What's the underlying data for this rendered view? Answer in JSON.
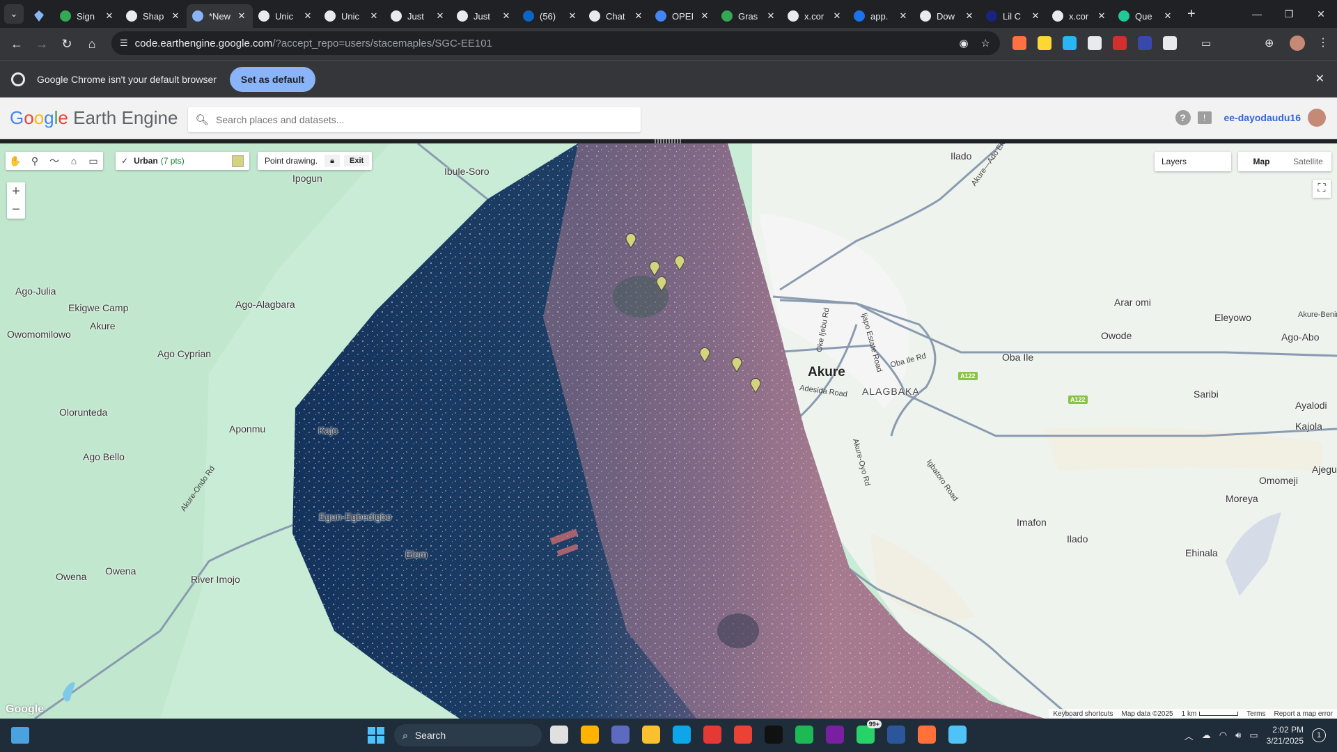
{
  "browser": {
    "tabs": [
      {
        "label": "Sign",
        "color": "#34a853",
        "active": false
      },
      {
        "label": "Shap",
        "color": "#e8eaed",
        "active": false
      },
      {
        "label": "*New",
        "color": "#8ab4f8",
        "active": true
      },
      {
        "label": "Unic",
        "color": "#e8eaed",
        "active": false
      },
      {
        "label": "Unic",
        "color": "#e8eaed",
        "active": false
      },
      {
        "label": "Just",
        "color": "#e8eaed",
        "active": false
      },
      {
        "label": "Just",
        "color": "#e8eaed",
        "active": false
      },
      {
        "label": "(56)",
        "color": "#0a66c2",
        "active": false
      },
      {
        "label": "Chat",
        "color": "#e8eaed",
        "active": false
      },
      {
        "label": "OPEI",
        "color": "#4285f4",
        "active": false
      },
      {
        "label": "Gras",
        "color": "#34a853",
        "active": false
      },
      {
        "label": "x.cor",
        "color": "#e8eaed",
        "active": false
      },
      {
        "label": "app.",
        "color": "#1a73e8",
        "active": false
      },
      {
        "label": "Dow",
        "color": "#e8eaed",
        "active": false
      },
      {
        "label": "Lil C",
        "color": "#1a237e",
        "active": false
      },
      {
        "label": "x.cor",
        "color": "#e8eaed",
        "active": false
      },
      {
        "label": "Que",
        "color": "#20c997",
        "active": false
      }
    ],
    "url_main": "code.earthengine.google.com",
    "url_rest": "/?accept_repo=users/stacemaples/SGC-EE101",
    "extension_colors": [
      "#ff7043",
      "#fdd835",
      "#29b6f6",
      "#e8eaed",
      "#d32f2f",
      "#3949ab",
      "#e8eaed"
    ]
  },
  "infobar": {
    "message": "Google Chrome isn't your default browser",
    "button": "Set as default"
  },
  "gee": {
    "logo_rest": "Earth Engine",
    "search_placeholder": "Search places and datasets...",
    "user": "ee-dayodaudu16"
  },
  "map": {
    "drawing": {
      "layer_name": "Urban",
      "layer_count": "(7 pts)",
      "layer_color": "#d4d47c",
      "mode_label": "Point drawing.",
      "exit_label": "Exit"
    },
    "layers_label": "Layers",
    "map_type": [
      "Map",
      "Satellite"
    ],
    "labels": [
      "Ipogun",
      "Ibule-Soro",
      "Ilado",
      "Ago-Julia",
      "Ekigwe Camp",
      "Akure",
      "Owomomilowo",
      "Ago-Alagbara",
      "Ago Cyprian",
      "Arar omi",
      "Eleyowo",
      "Owode",
      "Ago-Abo",
      "Oba Ile",
      "Saribi",
      "Ayalodi",
      "Kajola",
      "Olorunteda",
      "Aponmu",
      "Kajo",
      "Ago Bello",
      "Ajegu",
      "Omomeji",
      "Moreya",
      "Egun-Egbedigbo",
      "Imafon",
      "Ilado",
      "Ehinala",
      "Elem",
      "Owena",
      "Owena",
      "River Imojo"
    ],
    "town": "Akure",
    "district": "ALAGBAKA",
    "roads": [
      "Akure—Ado Ekiti",
      "Oke Ijebu Rd",
      "Ijapo Estate Road",
      "Oba Ile Rd",
      "Adesida Road",
      "Akure-Oyo Rd",
      "Igbatoro Road",
      "Akure-Ondo Rd",
      "Akure-Benin"
    ],
    "shield_label": "A122",
    "attribution": {
      "shortcuts": "Keyboard shortcuts",
      "data": "Map data ©2025",
      "scale": "1 km",
      "terms": "Terms",
      "report": "Report a map error"
    },
    "watermark": "Google"
  },
  "taskbar": {
    "search": "Search",
    "badge": "99+",
    "time": "2:02 PM",
    "date": "3/21/2025",
    "notifications": "1",
    "app_colors": [
      "#e0e0e0",
      "#ffb300",
      "#5c6bc0",
      "#fbc02d",
      "#0ea5e9",
      "#e53935",
      "#ea4335",
      "#111111",
      "#1db954",
      "#7b1fa2",
      "#25d366",
      "#2b579a",
      "#ff7139",
      "#4fc3f7"
    ]
  }
}
